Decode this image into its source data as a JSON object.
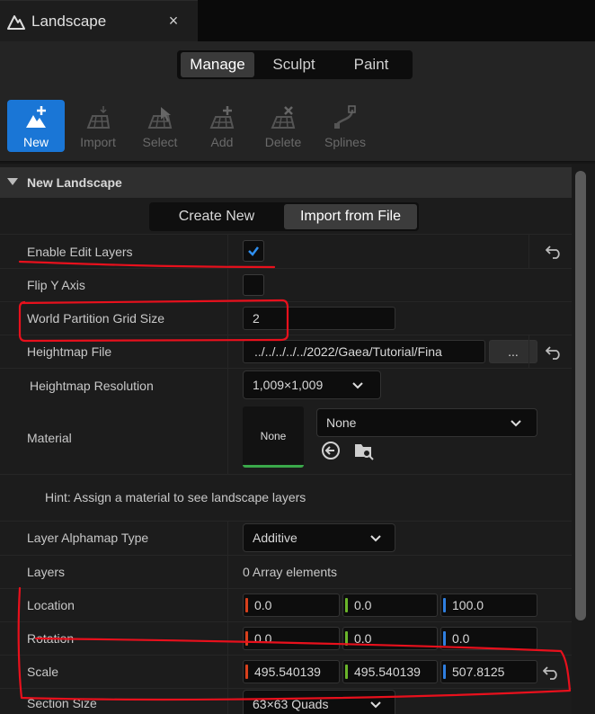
{
  "tab": {
    "title": "Landscape",
    "close": "×"
  },
  "modes": [
    "Manage",
    "Sculpt",
    "Paint"
  ],
  "tools": [
    {
      "label": "New",
      "icon": "new-landscape-icon"
    },
    {
      "label": "Import",
      "icon": "import-icon"
    },
    {
      "label": "Select",
      "icon": "select-icon"
    },
    {
      "label": "Add",
      "icon": "add-icon"
    },
    {
      "label": "Delete",
      "icon": "delete-icon"
    },
    {
      "label": "Splines",
      "icon": "splines-icon"
    }
  ],
  "section": {
    "title": "New Landscape"
  },
  "source_toggle": [
    "Create New",
    "Import from File"
  ],
  "rows": {
    "enable_edit_layers": {
      "label": "Enable Edit Layers",
      "checked": true
    },
    "flip_y_axis": {
      "label": "Flip Y Axis",
      "checked": false
    },
    "world_partition": {
      "label": "World Partition Grid Size",
      "value": "2"
    },
    "heightmap_file": {
      "label": "Heightmap File",
      "value": "../../../../../2022/Gaea/Tutorial/Fina",
      "browse": "..."
    },
    "heightmap_resolution": {
      "label": "Heightmap Resolution",
      "value": "1,009×1,009"
    },
    "material": {
      "label": "Material",
      "thumb": "None",
      "value": "None"
    },
    "hint": "Hint: Assign a material to see landscape layers",
    "layer_alphamap": {
      "label": "Layer Alphamap Type",
      "value": "Additive"
    },
    "layers": {
      "label": "Layers",
      "value": "0 Array elements"
    },
    "location": {
      "label": "Location",
      "x": "0.0",
      "y": "0.0",
      "z": "100.0"
    },
    "rotation": {
      "label": "Rotation",
      "x": "0.0",
      "y": "0.0",
      "z": "0.0"
    },
    "scale": {
      "label": "Scale",
      "x": "495.540139",
      "y": "495.540139",
      "z": "507.8125"
    },
    "section_size": {
      "label": "Section Size",
      "value": "63×63 Quads"
    }
  },
  "colors": {
    "accent": "#1a76d6",
    "axis_x": "#d8401c",
    "axis_y": "#6ab52a",
    "axis_z": "#2f7fe0",
    "annotation": "#e8101c",
    "material_ok": "#3aa84a"
  }
}
